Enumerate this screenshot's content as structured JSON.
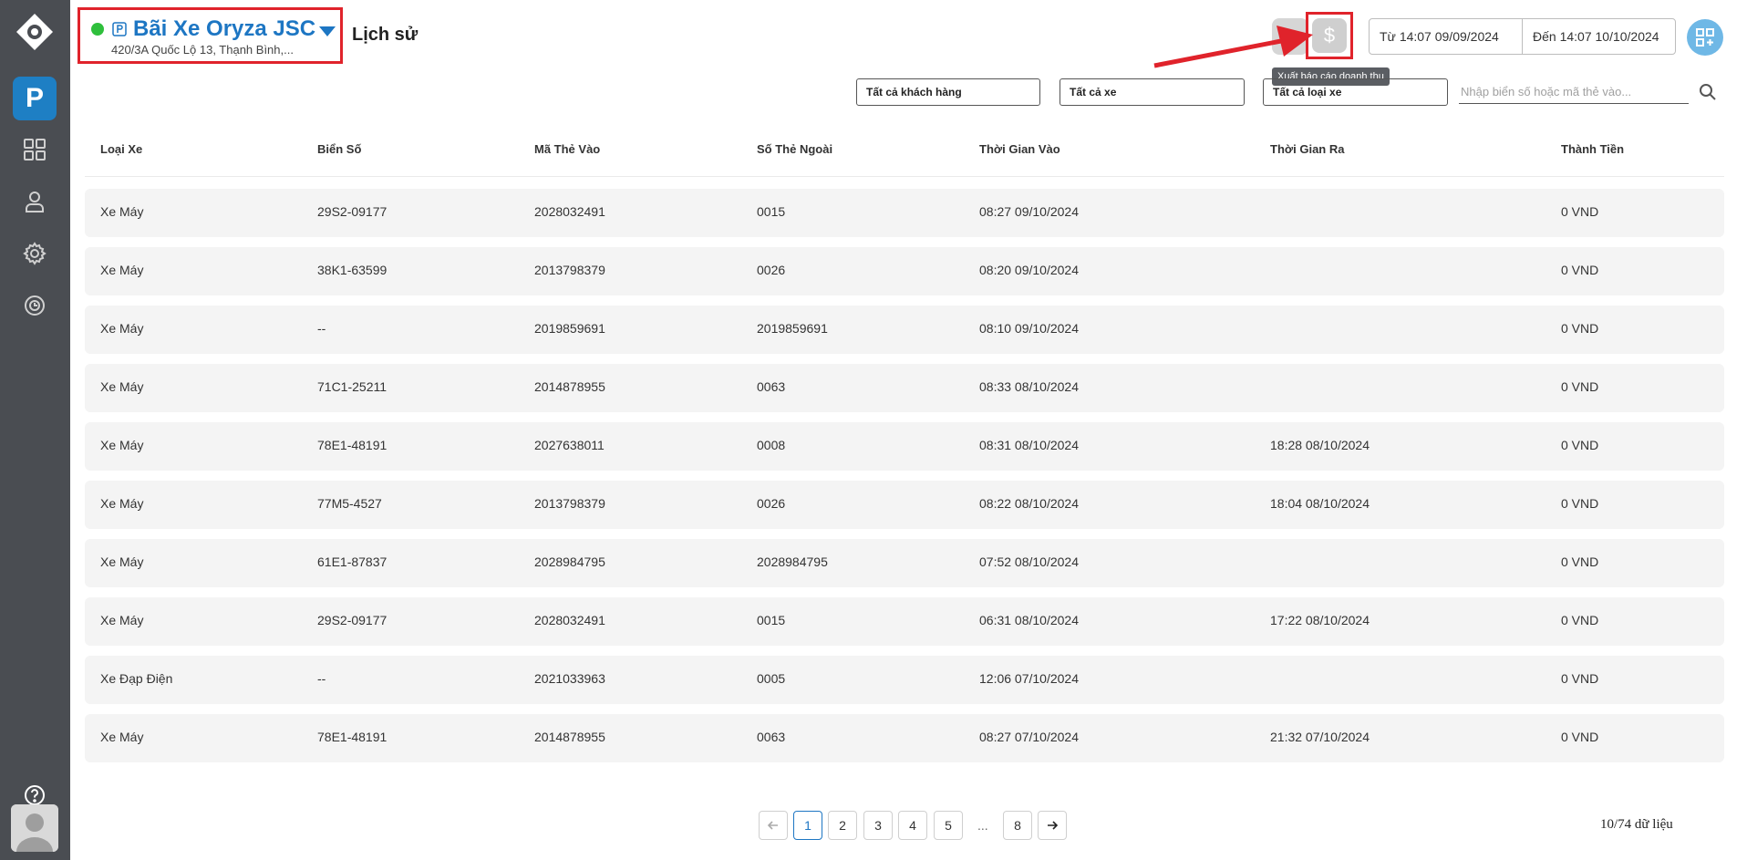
{
  "lot": {
    "name": "Bãi Xe Oryza JSC",
    "address": "420/3A Quốc Lộ 13, Thạnh Bình,..."
  },
  "page_title": "Lịch sử",
  "toolbar": {
    "export_symbol": "$",
    "export_tooltip": "Xuất báo cáo doanh thu",
    "date_from": "Từ 14:07 09/09/2024",
    "date_to": "Đến 14:07 10/10/2024"
  },
  "filters": {
    "customer": "Tất cả khách hàng",
    "vehicle": "Tất cả xe",
    "vehicle_type": "Tất cả loại xe",
    "search_placeholder": "Nhập biển số hoặc mã thẻ vào..."
  },
  "table": {
    "headers": [
      "Loại Xe",
      "Biển Số",
      "Mã Thẻ Vào",
      "Số Thẻ Ngoài",
      "Thời Gian Vào",
      "Thời Gian Ra",
      "Thành Tiền"
    ],
    "rows": [
      [
        "Xe Máy",
        "29S2-09177",
        "2028032491",
        "0015",
        "08:27 09/10/2024",
        "",
        "0 VND"
      ],
      [
        "Xe Máy",
        "38K1-63599",
        "2013798379",
        "0026",
        "08:20 09/10/2024",
        "",
        "0 VND"
      ],
      [
        "Xe Máy",
        "--",
        "2019859691",
        "2019859691",
        "08:10 09/10/2024",
        "",
        "0 VND"
      ],
      [
        "Xe Máy",
        "71C1-25211",
        "2014878955",
        "0063",
        "08:33 08/10/2024",
        "",
        "0 VND"
      ],
      [
        "Xe Máy",
        "78E1-48191",
        "2027638011",
        "0008",
        "08:31 08/10/2024",
        "18:28 08/10/2024",
        "0 VND"
      ],
      [
        "Xe Máy",
        "77M5-4527",
        "2013798379",
        "0026",
        "08:22 08/10/2024",
        "18:04 08/10/2024",
        "0 VND"
      ],
      [
        "Xe Máy",
        "61E1-87837",
        "2028984795",
        "2028984795",
        "07:52 08/10/2024",
        "",
        "0 VND"
      ],
      [
        "Xe Máy",
        "29S2-09177",
        "2028032491",
        "0015",
        "06:31 08/10/2024",
        "17:22 08/10/2024",
        "0 VND"
      ],
      [
        "Xe Đạp Điện",
        "--",
        "2021033963",
        "0005",
        "12:06 07/10/2024",
        "",
        "0 VND"
      ],
      [
        "Xe Máy",
        "78E1-48191",
        "2014878955",
        "0063",
        "08:27 07/10/2024",
        "21:32 07/10/2024",
        "0 VND"
      ]
    ]
  },
  "pagination": {
    "pages": [
      "1",
      "2",
      "3",
      "4",
      "5"
    ],
    "ellipsis": "...",
    "last_page": "8",
    "active_page": "1",
    "count_label": "10/74 dữ liệu"
  },
  "sidebar": {
    "brand_letter": "P",
    "items": [
      "dashboard-icon",
      "user-icon",
      "settings-icon",
      "history-icon"
    ]
  },
  "colors": {
    "sidebar": "#4a4d52",
    "accent": "#1d76c3",
    "highlight": "#e0232b",
    "status_online": "#2fbf3c"
  }
}
